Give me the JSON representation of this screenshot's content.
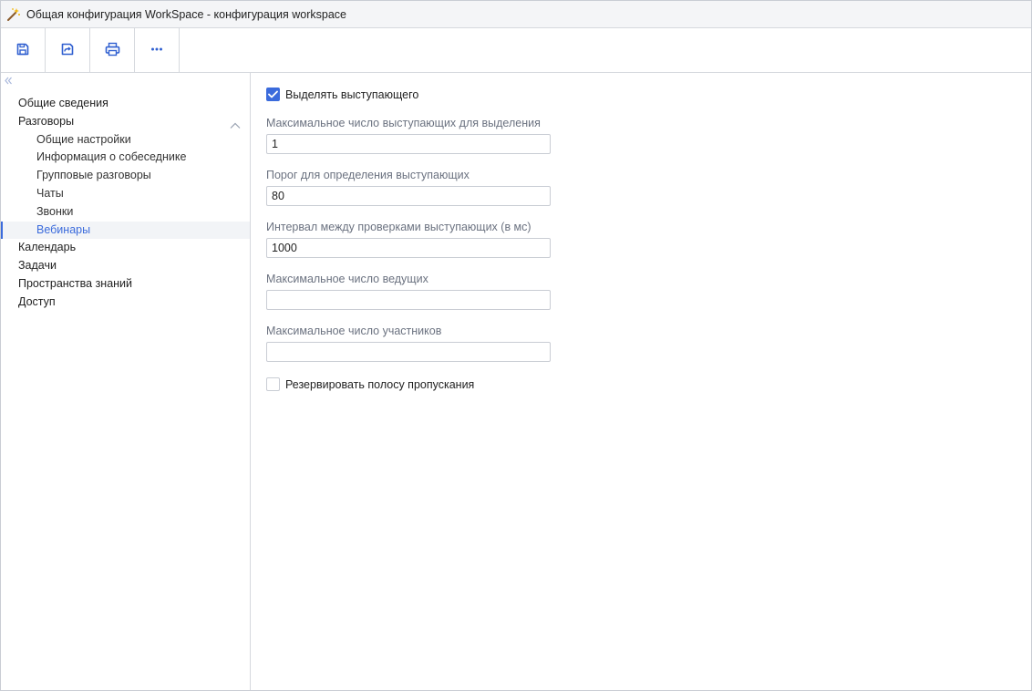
{
  "window": {
    "title": "Общая конфигурация WorkSpace - конфигурация workspace",
    "title_icon": "magic-wand-icon"
  },
  "toolbar": {
    "buttons": [
      {
        "name": "save",
        "icon": "save-icon"
      },
      {
        "name": "save-and-close",
        "icon": "save-and-close-icon"
      },
      {
        "name": "print",
        "icon": "print-icon"
      },
      {
        "name": "more",
        "icon": "more-icon"
      }
    ]
  },
  "sidebar": {
    "collapse_icon": "double-chevron-left-icon",
    "items": [
      {
        "label": "Общие сведения",
        "level": 0
      },
      {
        "label": "Разговоры",
        "level": 0,
        "expanded": true
      },
      {
        "label": "Общие настройки",
        "level": 1
      },
      {
        "label": "Информация о собеседнике",
        "level": 1
      },
      {
        "label": "Групповые разговоры",
        "level": 1
      },
      {
        "label": "Чаты",
        "level": 1
      },
      {
        "label": "Звонки",
        "level": 1
      },
      {
        "label": "Вебинары",
        "level": 1,
        "active": true
      },
      {
        "label": "Календарь",
        "level": 0
      },
      {
        "label": "Задачи",
        "level": 0
      },
      {
        "label": "Пространства знаний",
        "level": 0
      },
      {
        "label": "Доступ",
        "level": 0
      }
    ]
  },
  "form": {
    "highlight_speaker": {
      "label": "Выделять выступающего",
      "checked": true
    },
    "fields": [
      {
        "label": "Максимальное число выступающих для выделения",
        "value": "1"
      },
      {
        "label": "Порог для определения выступающих",
        "value": "80"
      },
      {
        "label": "Интервал между проверками выступающих (в мс)",
        "value": "1000"
      },
      {
        "label": "Максимальное число ведущих",
        "value": ""
      },
      {
        "label": "Максимальное число участников",
        "value": ""
      }
    ],
    "reserve_bandwidth": {
      "label": "Резервировать полосу пропускания",
      "checked": false
    }
  },
  "colors": {
    "accent": "#3b6bdc",
    "border": "#c9cdd4",
    "muted_text": "#6b7280"
  }
}
